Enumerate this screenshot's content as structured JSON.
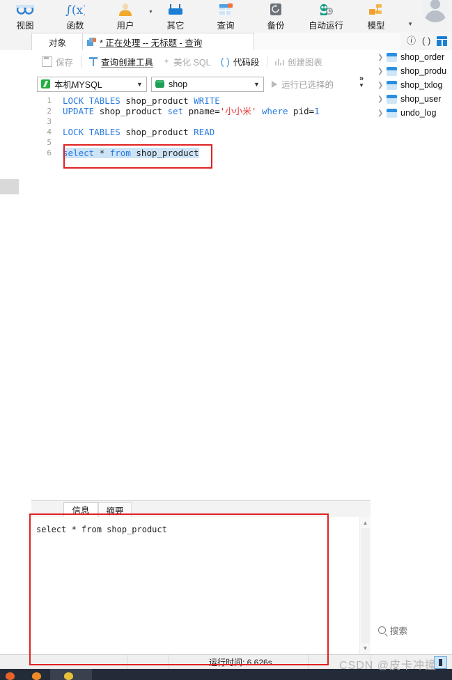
{
  "app": {
    "ribbon": {
      "items": [
        {
          "label": "视图",
          "icon": "view-icon"
        },
        {
          "label": "函数",
          "icon": "function-icon"
        },
        {
          "label": "用户",
          "icon": "user-icon"
        },
        {
          "label": "其它",
          "icon": "other-icon"
        },
        {
          "label": "查询",
          "icon": "query-icon"
        },
        {
          "label": "备份",
          "icon": "backup-icon"
        },
        {
          "label": "自动运行",
          "icon": "automation-icon"
        },
        {
          "label": "模型",
          "icon": "model-icon"
        }
      ]
    },
    "tabs": {
      "object_tab": "对象",
      "query_tab": "* 正在处理 -- 无标题 - 查询"
    },
    "toolbar": {
      "save": "保存",
      "query_builder": "查询创建工具",
      "beautify_sql": "美化 SQL",
      "code_snippet": "代码段",
      "create_chart": "创建图表"
    },
    "toolbar2": {
      "connection": "本机MYSQL",
      "database": "shop",
      "run_selected": "运行已选择的"
    }
  },
  "editor": {
    "lines": [
      {
        "num": "1",
        "text": "LOCK TABLES shop_product WRITE"
      },
      {
        "num": "2",
        "text": "UPDATE shop_product set pname='小小米' where pid=1"
      },
      {
        "num": "3",
        "text": ""
      },
      {
        "num": "4",
        "text": "LOCK TABLES shop_product READ"
      },
      {
        "num": "5",
        "text": ""
      },
      {
        "num": "6",
        "text": "select * from shop_product"
      }
    ],
    "tokens": {
      "l1_kw1": "LOCK TABLES ",
      "l1_id": "shop_product",
      "l1_kw2": " WRITE",
      "l2_kw1": "UPDATE ",
      "l2_id": "shop_product",
      "l2_kw2": " set ",
      "l2_col": "pname=",
      "l2_str": "'小小米'",
      "l2_kw3": " where ",
      "l2_col2": "pid=",
      "l2_num": "1",
      "l4_kw1": "LOCK TABLES ",
      "l4_id": "shop_product",
      "l4_kw2": " READ",
      "l6_kw1": "select ",
      "l6_star": "* ",
      "l6_kw2": "from ",
      "l6_id": "shop_product"
    }
  },
  "bottom": {
    "tab_info": "信息",
    "tab_summary": "摘要",
    "message": "select * from shop_product"
  },
  "status": {
    "run_time": "运行时间: 6.626s"
  },
  "sidebar": {
    "tree": [
      {
        "label": "shop_order",
        "icon": "table-icon"
      },
      {
        "label": "shop_produ",
        "icon": "table-icon"
      },
      {
        "label": "shop_txlog",
        "icon": "table-icon"
      },
      {
        "label": "shop_user",
        "icon": "table-icon"
      },
      {
        "label": "undo_log",
        "icon": "table-icon"
      }
    ],
    "search_placeholder": "搜索"
  },
  "watermark": {
    "text": "CSDN @皮卡冲撞"
  },
  "colors": {
    "accent_blue": "#2a7ae2",
    "keyword_blue": "#2a7ae2",
    "string_red": "#e0322e",
    "selection": "#cde4f7",
    "annotation_red": "#e02020",
    "ribbon_bg": "#f3f3f3"
  }
}
